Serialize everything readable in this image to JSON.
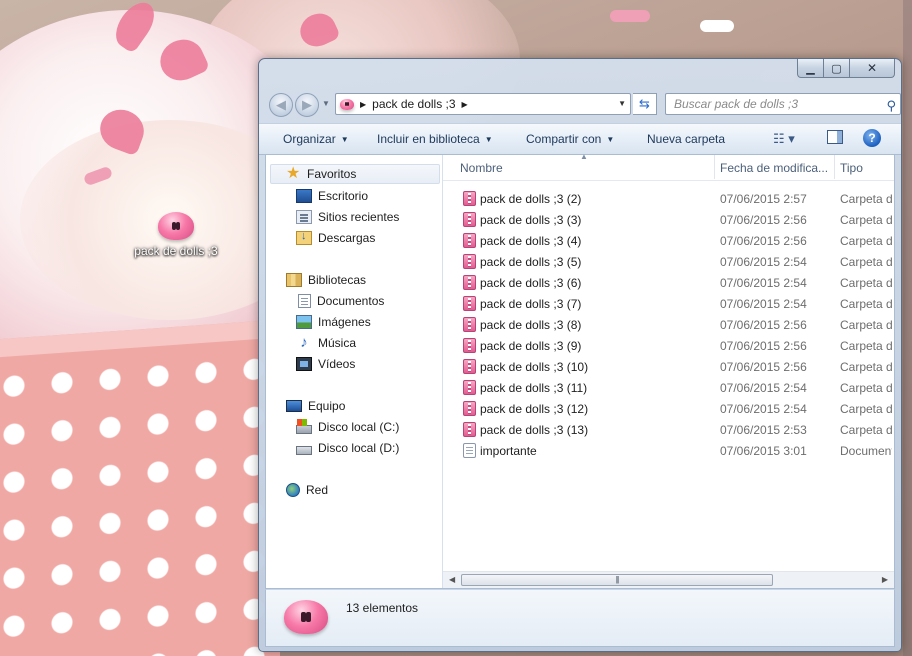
{
  "desktop": {
    "icon_label": "pack de dolls ;3"
  },
  "window": {
    "minimize_glyph": "▁",
    "maximize_glyph": "▢",
    "close_glyph": "✕",
    "back_glyph": "◀",
    "forward_glyph": "▶",
    "refresh_glyph": "⇆",
    "address": {
      "path": [
        "pack de dolls ;3"
      ],
      "separator": "▶"
    },
    "search": {
      "placeholder": "Buscar pack de dolls ;3"
    },
    "toolbar": {
      "organize": "Organizar",
      "include": "Incluir en biblioteca",
      "share": "Compartir con",
      "new_folder": "Nueva carpeta",
      "view_glyph": "☷ ▾",
      "help_glyph": "?"
    },
    "nav": {
      "favorites": "Favoritos",
      "desktop": "Escritorio",
      "recent": "Sitios recientes",
      "downloads": "Descargas",
      "libraries": "Bibliotecas",
      "documents": "Documentos",
      "images": "Imágenes",
      "music": "Música",
      "videos": "Vídeos",
      "computer": "Equipo",
      "drive_c": "Disco local (C:)",
      "drive_d": "Disco local (D:)",
      "network": "Red"
    },
    "columns": {
      "name": "Nombre",
      "date": "Fecha de modifica...",
      "type": "Tipo"
    },
    "files": [
      {
        "name": "pack de dolls ;3 (2)",
        "date": "07/06/2015 2:57",
        "type": "Carpeta de"
      },
      {
        "name": "pack de dolls ;3 (3)",
        "date": "07/06/2015 2:56",
        "type": "Carpeta de"
      },
      {
        "name": "pack de dolls ;3 (4)",
        "date": "07/06/2015 2:56",
        "type": "Carpeta de"
      },
      {
        "name": "pack de dolls ;3 (5)",
        "date": "07/06/2015 2:54",
        "type": "Carpeta de"
      },
      {
        "name": "pack de dolls ;3 (6)",
        "date": "07/06/2015 2:54",
        "type": "Carpeta de"
      },
      {
        "name": "pack de dolls ;3 (7)",
        "date": "07/06/2015 2:54",
        "type": "Carpeta de"
      },
      {
        "name": "pack de dolls ;3 (8)",
        "date": "07/06/2015 2:56",
        "type": "Carpeta de"
      },
      {
        "name": "pack de dolls ;3 (9)",
        "date": "07/06/2015 2:56",
        "type": "Carpeta de"
      },
      {
        "name": "pack de dolls ;3 (10)",
        "date": "07/06/2015 2:56",
        "type": "Carpeta de"
      },
      {
        "name": "pack de dolls ;3 (11)",
        "date": "07/06/2015 2:54",
        "type": "Carpeta de"
      },
      {
        "name": "pack de dolls ;3 (12)",
        "date": "07/06/2015 2:54",
        "type": "Carpeta de"
      },
      {
        "name": "pack de dolls ;3 (13)",
        "date": "07/06/2015 2:53",
        "type": "Carpeta de"
      },
      {
        "name": "importante",
        "date": "07/06/2015 3:01",
        "type": "Document"
      }
    ],
    "status": {
      "count": "13 elementos"
    }
  }
}
